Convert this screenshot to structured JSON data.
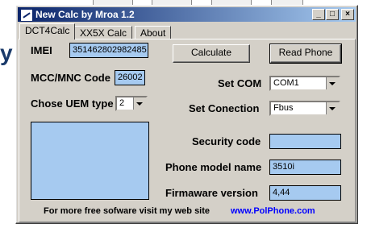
{
  "window": {
    "title": "New Calc by Mroa 1.2",
    "controls": {
      "minimize": "_",
      "maximize": "□",
      "close": "×"
    }
  },
  "tabs": [
    {
      "label": "DCT4Calc",
      "active": true
    },
    {
      "label": "XX5X Calc",
      "active": false
    },
    {
      "label": "About",
      "active": false
    }
  ],
  "left": {
    "imei_label": "IMEI",
    "imei_value": "351462802982485",
    "mcc_label": "MCC/MNC Code",
    "mcc_value": "26002",
    "uem_label": "Chose UEM type",
    "uem_value": "2"
  },
  "right": {
    "calculate_label": "Calculate",
    "read_phone_label": "Read Phone",
    "set_com_label": "Set COM",
    "set_com_value": "COM1",
    "set_connection_label": "Set Conection",
    "set_connection_value": "Fbus",
    "security_label": "Security code",
    "security_value": "",
    "model_label": "Phone model name",
    "model_value": "3510i",
    "firmware_label": "Firmaware version",
    "firmware_value": "4,44"
  },
  "footer": {
    "text": "For more free sofware visit my web site",
    "link": "www.PolPhone.com"
  },
  "background": {
    "partial_letter": "y"
  },
  "colors": {
    "titlebar_start": "#0a246a",
    "titlebar_end": "#a6caf0",
    "field_bg": "#a6caf0",
    "link": "#0000ff"
  }
}
